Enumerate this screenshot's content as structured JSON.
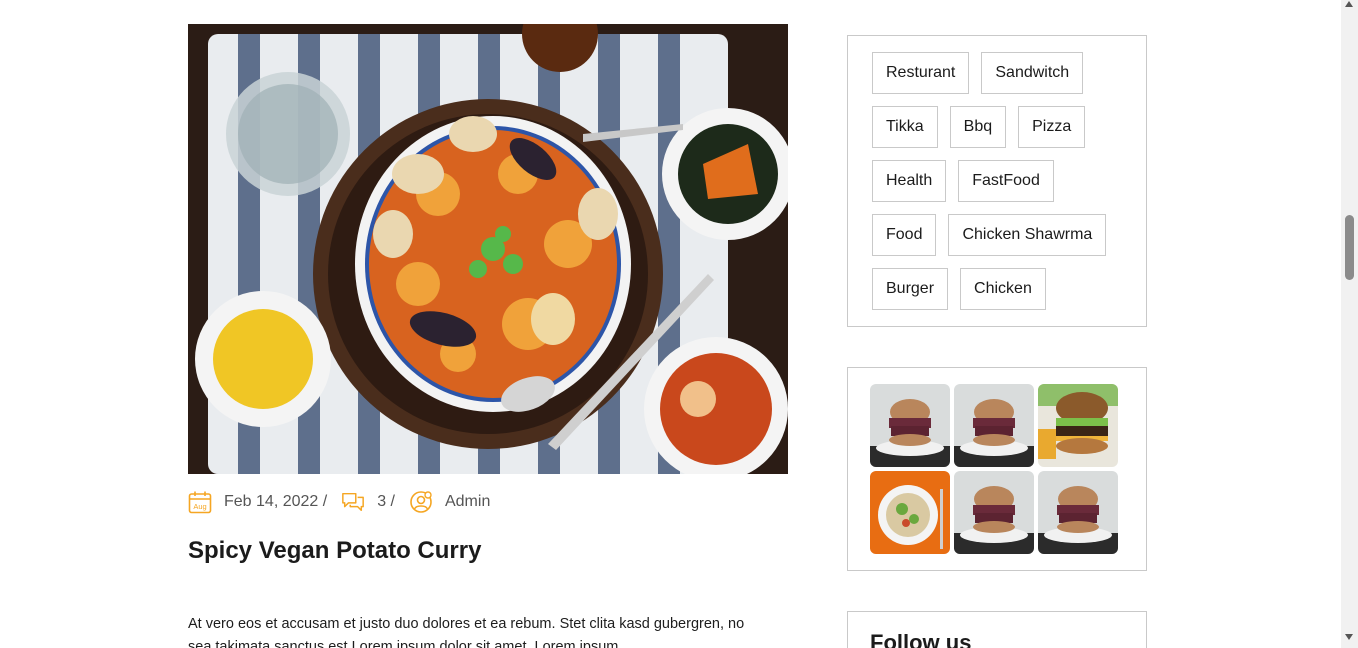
{
  "post": {
    "date": "Feb 14, 2022 /",
    "date_badge": "Aug",
    "comments": "3 /",
    "author": "Admin",
    "title": "Spicy Vegan Potato Curry",
    "excerpt": "At vero eos et accusam et justo duo dolores et ea rebum. Stet clita kasd gubergren, no sea takimata sanctus est Lorem ipsum dolor sit amet. Lorem ipsum"
  },
  "sidebar": {
    "tags": [
      [
        "Resturant",
        "Sandwitch"
      ],
      [
        "Tikka",
        "Bbq",
        "Pizza"
      ],
      [
        "Health",
        "FastFood"
      ],
      [
        "Food",
        "Chicken Shawrma"
      ],
      [
        "Burger",
        "Chicken"
      ]
    ],
    "gallery": [
      "burger",
      "burger",
      "burger-fries",
      "salad",
      "burger",
      "burger"
    ],
    "follow_title": "Follow us"
  },
  "colors": {
    "accent": "#f5a623",
    "border": "#c9c9c9",
    "text": "#1d1d1d",
    "meta_text": "#555555"
  },
  "icons": [
    "calendar-icon",
    "comments-icon",
    "user-icon"
  ]
}
